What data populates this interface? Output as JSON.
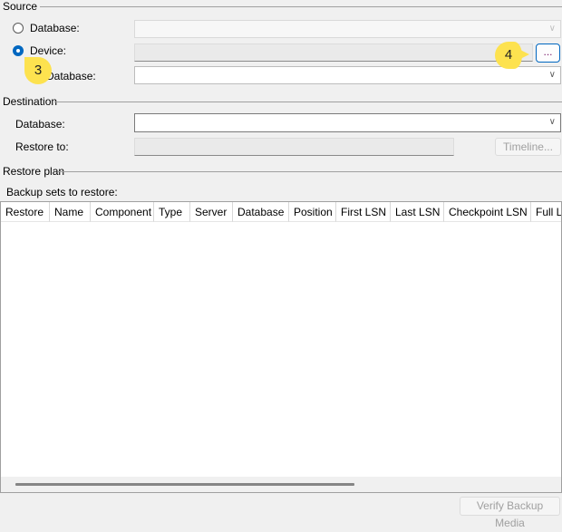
{
  "source": {
    "title": "Source",
    "database_label": "Database:",
    "device_label": "Device:",
    "device_database_label": "Database:",
    "browse_label": "...",
    "selected": "device"
  },
  "destination": {
    "title": "Destination",
    "database_label": "Database:",
    "restore_to_label": "Restore to:",
    "timeline_label": "Timeline..."
  },
  "restore_plan": {
    "title": "Restore plan",
    "backup_sets_label": "Backup sets to restore:",
    "columns": [
      "Restore",
      "Name",
      "Component",
      "Type",
      "Server",
      "Database",
      "Position",
      "First LSN",
      "Last LSN",
      "Checkpoint LSN",
      "Full LSN"
    ]
  },
  "verify_label": "Verify Backup Media",
  "callouts": [
    "3",
    "4"
  ],
  "colors": {
    "accent": "#0067c0",
    "callout": "#fde24f"
  }
}
